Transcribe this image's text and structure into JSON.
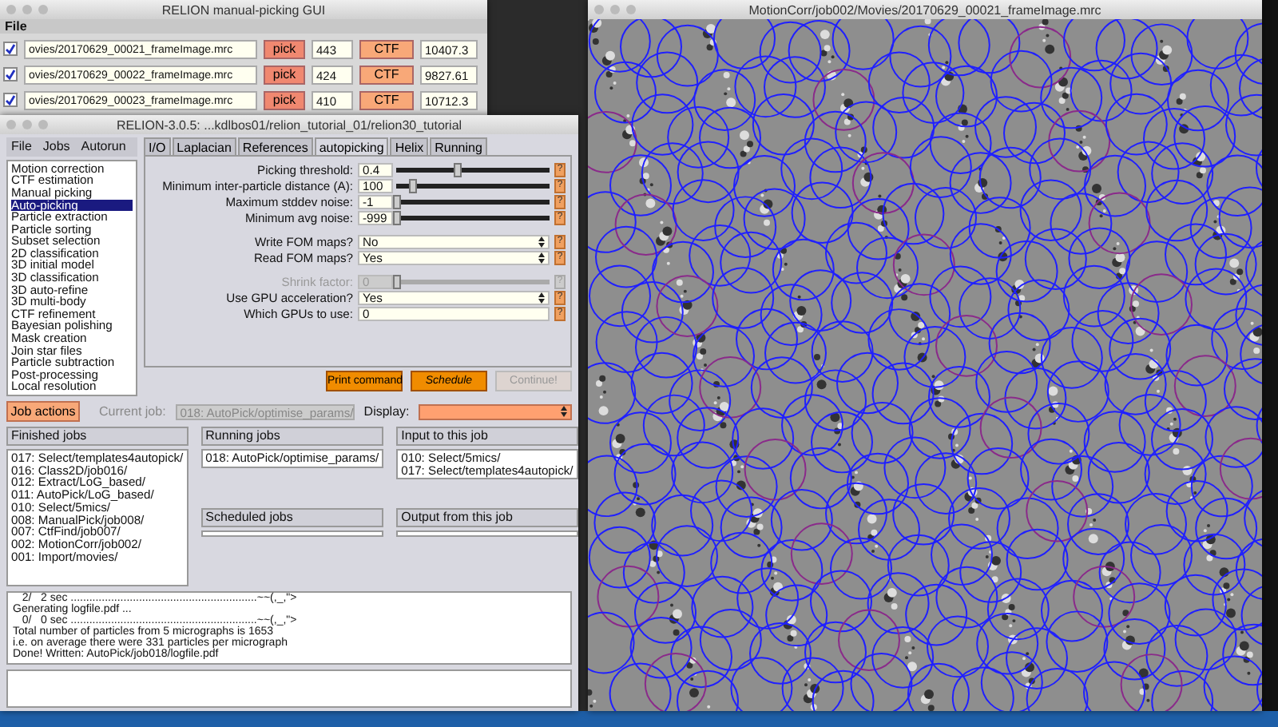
{
  "picking_window": {
    "title": "RELION manual-picking GUI",
    "menu": [
      "File"
    ],
    "rows": [
      {
        "checked": true,
        "file": "ovies/20170629_00021_frameImage.mrc",
        "pick": "pick",
        "count": "443",
        "ctf": "CTF",
        "value": "10407.3"
      },
      {
        "checked": true,
        "file": "ovies/20170629_00022_frameImage.mrc",
        "pick": "pick",
        "count": "424",
        "ctf": "CTF",
        "value": "9827.61"
      },
      {
        "checked": true,
        "file": "ovies/20170629_00023_frameImage.mrc",
        "pick": "pick",
        "count": "410",
        "ctf": "CTF",
        "value": "10712.3"
      }
    ]
  },
  "micrograph_window": {
    "title": "MotionCorr/job002/Movies/20170629_00021_frameImage.mrc"
  },
  "main_window": {
    "title": "RELION-3.0.5: ...kdlbos01/relion_tutorial_01/relion30_tutorial",
    "menu": [
      "File",
      "Jobs",
      "Autorun"
    ],
    "job_types": [
      {
        "label": "Motion correction",
        "selected": false
      },
      {
        "label": "CTF estimation",
        "selected": false
      },
      {
        "label": "Manual picking",
        "selected": false
      },
      {
        "label": "Auto-picking",
        "selected": true
      },
      {
        "label": "Particle extraction",
        "selected": false
      },
      {
        "label": "Particle sorting",
        "selected": false
      },
      {
        "label": "Subset selection",
        "selected": false
      },
      {
        "label": "2D classification",
        "selected": false
      },
      {
        "label": "3D initial model",
        "selected": false
      },
      {
        "label": "3D classification",
        "selected": false
      },
      {
        "label": "3D auto-refine",
        "selected": false
      },
      {
        "label": "3D multi-body",
        "selected": false
      },
      {
        "label": "CTF refinement",
        "selected": false
      },
      {
        "label": "Bayesian polishing",
        "selected": false
      },
      {
        "label": "Mask creation",
        "selected": false
      },
      {
        "label": "Join star files",
        "selected": false
      },
      {
        "label": "Particle subtraction",
        "selected": false
      },
      {
        "label": "Post-processing",
        "selected": false
      },
      {
        "label": "Local resolution",
        "selected": false
      }
    ],
    "tabs": [
      {
        "label": "I/O",
        "selected": false
      },
      {
        "label": "Laplacian",
        "selected": false
      },
      {
        "label": "References",
        "selected": false
      },
      {
        "label": "autopicking",
        "selected": true
      },
      {
        "label": "Helix",
        "selected": false
      },
      {
        "label": "Running",
        "selected": false
      }
    ],
    "option_groups": [
      [
        {
          "kind": "slider",
          "label": "Picking threshold:",
          "value": "0.4",
          "level": 0.4,
          "disabled": false,
          "help": "?"
        },
        {
          "kind": "slider",
          "label": "Minimum inter-particle distance (A):",
          "value": "100",
          "level": 0.1,
          "disabled": false,
          "help": "?"
        },
        {
          "kind": "slider",
          "label": "Maximum stddev noise:",
          "value": "-1",
          "level": 0,
          "disabled": false,
          "help": "?"
        },
        {
          "kind": "slider",
          "label": "Minimum avg noise:",
          "value": "-999",
          "level": 0,
          "disabled": false,
          "help": "?"
        }
      ],
      [
        {
          "kind": "select",
          "label": "Write FOM maps?",
          "value": "No",
          "disabled": false,
          "help": "?"
        },
        {
          "kind": "select",
          "label": "Read FOM maps?",
          "value": "Yes",
          "disabled": false,
          "help": "?"
        }
      ],
      [
        {
          "kind": "slider",
          "label": "Shrink factor:",
          "value": "0",
          "level": 0,
          "disabled": true,
          "help": "?"
        },
        {
          "kind": "select",
          "label": "Use GPU acceleration?",
          "value": "Yes",
          "disabled": false,
          "help": "?"
        },
        {
          "kind": "text",
          "label": "Which GPUs to use:",
          "value": "0",
          "disabled": false,
          "help": "?"
        }
      ]
    ],
    "actions": [
      {
        "label": "Print command",
        "disabled": false,
        "italic": false
      },
      {
        "label": "Schedule",
        "disabled": false,
        "italic": true
      },
      {
        "label": "Continue!",
        "disabled": true,
        "italic": false
      }
    ],
    "job_actions": "Job actions",
    "current_job_label": "Current job:",
    "current_job": "018: AutoPick/optimise_params/",
    "display_label": "Display:",
    "finished_jobs": {
      "title": "Finished jobs",
      "items": [
        "017: Select/templates4autopick/",
        "016: Class2D/job016/",
        "012: Extract/LoG_based/",
        "011: AutoPick/LoG_based/",
        "010: Select/5mics/",
        "008: ManualPick/job008/",
        "007: CtfFind/job007/",
        "002: MotionCorr/job002/",
        "001: Import/movies/"
      ]
    },
    "running_jobs": {
      "title": "Running jobs",
      "items": [
        "018: AutoPick/optimise_params/"
      ]
    },
    "scheduled_jobs": {
      "title": "Scheduled jobs"
    },
    "input_jobs": {
      "title": "Input to this job",
      "items": [
        "010: Select/5mics/",
        "017: Select/templates4autopick/"
      ]
    },
    "output_jobs": {
      "title": "Output from this job"
    },
    "log": [
      "   2/   2 sec ............................................................~~(,_,\">",
      "Generating logfile.pdf ...",
      "   0/   0 sec ............................................................~~(,_,\">",
      "Total number of particles from 5 micrographs is 1653",
      "i.e. on average there were 331 particles per micrograph",
      "Done! Written: AutoPick/job018/logfile.pdf"
    ]
  }
}
